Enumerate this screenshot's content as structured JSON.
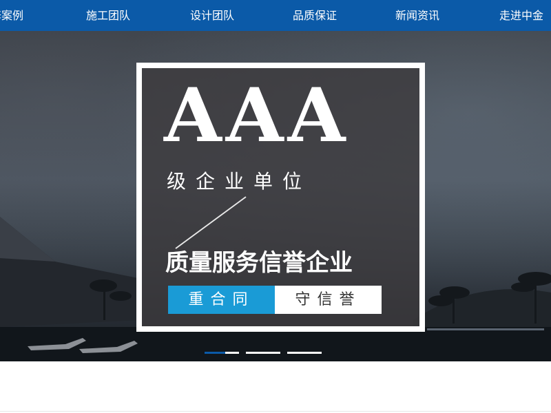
{
  "nav": {
    "items": [
      {
        "label": "修案例"
      },
      {
        "label": "施工团队"
      },
      {
        "label": "设计团队"
      },
      {
        "label": "品质保证"
      },
      {
        "label": "新闻资讯"
      },
      {
        "label": "走进中金"
      }
    ]
  },
  "banner": {
    "rating": "AAA",
    "rating_sub": "级企业单位",
    "tagline": "质量服务信誉企业",
    "badge_left": "重合同",
    "badge_right": "守信誉",
    "slides": 3,
    "active_slide": 1
  },
  "colors": {
    "nav_bg": "#0b5aa8",
    "badge_blue": "#1a9bd6",
    "white": "#ffffff"
  }
}
